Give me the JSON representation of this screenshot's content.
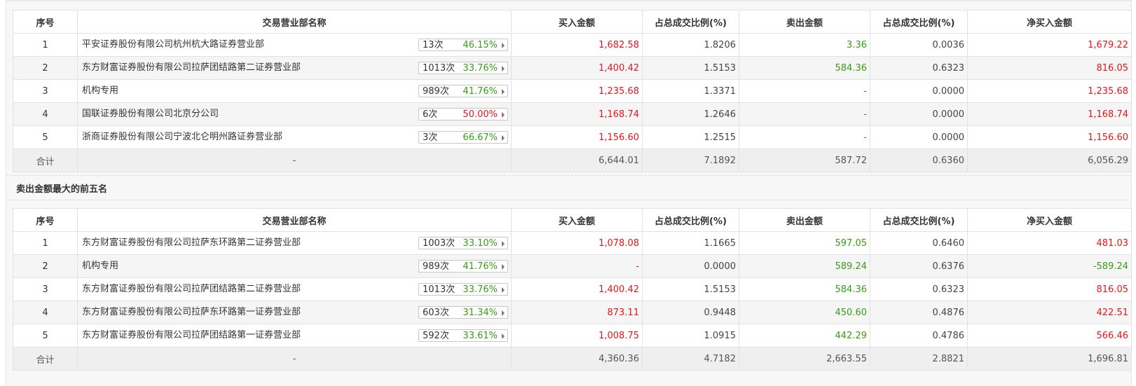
{
  "headers": [
    "序号",
    "交易营业部名称",
    "买入金额",
    "占总成交比例(%)",
    "卖出金额",
    "占总成交比例(%)",
    "净买入金额"
  ],
  "colors": {
    "red": "#e6161e",
    "green": "#3a9a1a"
  },
  "buy_top": {
    "rows": [
      {
        "idx": "1",
        "name": "平安证券股份有限公司杭州杭大路证券营业部",
        "times": "13次",
        "rate": "46.15%",
        "rate_color": "green",
        "buy": "1,682.58",
        "buy_pct": "1.8206",
        "sell": "3.36",
        "sell_pct": "0.0036",
        "net": "1,679.22",
        "net_color": "red"
      },
      {
        "idx": "2",
        "name": "东方财富证券股份有限公司拉萨团结路第二证券营业部",
        "times": "1013次",
        "rate": "33.76%",
        "rate_color": "green",
        "buy": "1,400.42",
        "buy_pct": "1.5153",
        "sell": "584.36",
        "sell_pct": "0.6323",
        "net": "816.05",
        "net_color": "red"
      },
      {
        "idx": "3",
        "name": "机构专用",
        "times": "989次",
        "rate": "41.76%",
        "rate_color": "green",
        "buy": "1,235.68",
        "buy_pct": "1.3371",
        "sell": "-",
        "sell_pct": "0.0000",
        "net": "1,235.68",
        "net_color": "red"
      },
      {
        "idx": "4",
        "name": "国联证券股份有限公司北京分公司",
        "times": "6次",
        "rate": "50.00%",
        "rate_color": "red",
        "buy": "1,168.74",
        "buy_pct": "1.2646",
        "sell": "-",
        "sell_pct": "0.0000",
        "net": "1,168.74",
        "net_color": "red"
      },
      {
        "idx": "5",
        "name": "浙商证券股份有限公司宁波北仑明州路证券营业部",
        "times": "3次",
        "rate": "66.67%",
        "rate_color": "green",
        "buy": "1,156.60",
        "buy_pct": "1.2515",
        "sell": "-",
        "sell_pct": "0.0000",
        "net": "1,156.60",
        "net_color": "red"
      }
    ],
    "total": {
      "label": "合计",
      "name": "-",
      "buy": "6,644.01",
      "buy_pct": "7.1892",
      "sell": "587.72",
      "sell_pct": "0.6360",
      "net": "6,056.29"
    }
  },
  "sell_title": "卖出金额最大的前五名",
  "sell_top": {
    "rows": [
      {
        "idx": "1",
        "name": "东方财富证券股份有限公司拉萨东环路第二证券营业部",
        "times": "1003次",
        "rate": "33.10%",
        "rate_color": "green",
        "buy": "1,078.08",
        "buy_pct": "1.1665",
        "sell": "597.05",
        "sell_pct": "0.6460",
        "net": "481.03",
        "net_color": "red"
      },
      {
        "idx": "2",
        "name": "机构专用",
        "times": "989次",
        "rate": "41.76%",
        "rate_color": "green",
        "buy": "-",
        "buy_pct": "0.0000",
        "sell": "589.24",
        "sell_pct": "0.6376",
        "net": "-589.24",
        "net_color": "green"
      },
      {
        "idx": "3",
        "name": "东方财富证券股份有限公司拉萨团结路第二证券营业部",
        "times": "1013次",
        "rate": "33.76%",
        "rate_color": "green",
        "buy": "1,400.42",
        "buy_pct": "1.5153",
        "sell": "584.36",
        "sell_pct": "0.6323",
        "net": "816.05",
        "net_color": "red"
      },
      {
        "idx": "4",
        "name": "东方财富证券股份有限公司拉萨东环路第一证券营业部",
        "times": "603次",
        "rate": "31.34%",
        "rate_color": "green",
        "buy": "873.11",
        "buy_pct": "0.9448",
        "sell": "450.60",
        "sell_pct": "0.4876",
        "net": "422.51",
        "net_color": "red"
      },
      {
        "idx": "5",
        "name": "东方财富证券股份有限公司拉萨团结路第一证券营业部",
        "times": "592次",
        "rate": "33.61%",
        "rate_color": "green",
        "buy": "1,008.75",
        "buy_pct": "1.0915",
        "sell": "442.29",
        "sell_pct": "0.4786",
        "net": "566.46",
        "net_color": "red"
      }
    ],
    "total": {
      "label": "合计",
      "name": "-",
      "buy": "4,360.36",
      "buy_pct": "4.7182",
      "sell": "2,663.55",
      "sell_pct": "2.8821",
      "net": "1,696.81"
    }
  }
}
